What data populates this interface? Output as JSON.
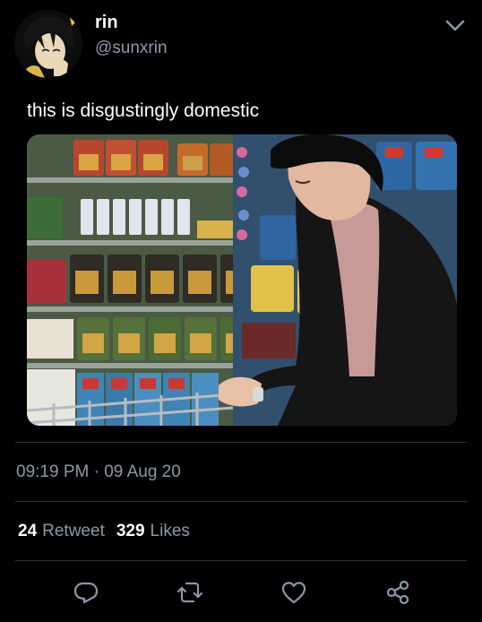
{
  "author": {
    "display_name": "rin",
    "handle": "@sunxrin"
  },
  "tweet": {
    "text": "this is disgustingly domestic",
    "timestamp": "09:19 PM · 09 Aug 20"
  },
  "stats": {
    "retweets_count": "24",
    "retweets_label": "Retweet",
    "likes_count": "329",
    "likes_label": "Likes"
  },
  "icons": {
    "more": "chevron-down-icon",
    "reply": "reply-icon",
    "retweet": "retweet-icon",
    "like": "heart-icon",
    "share": "share-icon"
  },
  "colors": {
    "background": "#000000",
    "text_primary": "#ffffff",
    "text_secondary": "#8b98a5",
    "divider": "#2f3336"
  }
}
